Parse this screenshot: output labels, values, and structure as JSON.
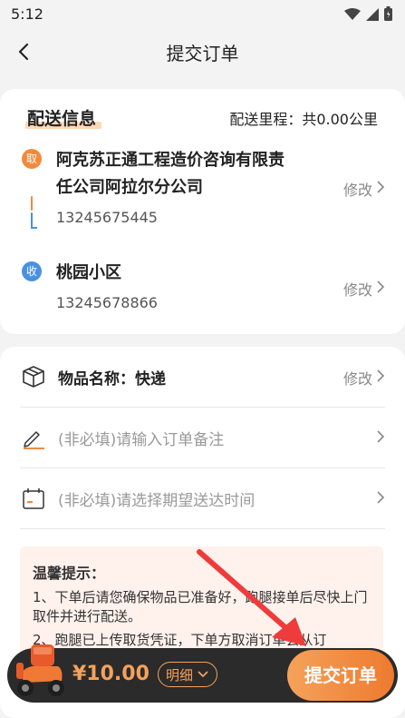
{
  "status": {
    "time": "5:12"
  },
  "nav": {
    "title": "提交订单"
  },
  "delivery": {
    "section_title": "配送信息",
    "distance": "配送里程：共0.00公里",
    "pickup": {
      "badge": "取",
      "name_line1": "阿克苏正通工程造价咨询有限责",
      "name_line2": "任公司阿拉尔分公司",
      "phone": "13245675445",
      "edit_label": "修改"
    },
    "receive": {
      "badge": "收",
      "name": "桃园小区",
      "phone": "13245678866",
      "edit_label": "修改"
    }
  },
  "item": {
    "label": "物品名称：快递",
    "edit_label": "修改",
    "remark_placeholder": "(非必填)请输入订单备注",
    "time_placeholder": "(非必填)请选择期望送达时间"
  },
  "tips": {
    "title": "温馨提示：",
    "lines": [
      "1、下单后请您确保物品已准备好，跑腿接单后尽快上门取件并进行配送。",
      "2、跑腿已上传取货凭证，下单方取消订单会从订"
    ]
  },
  "bottom": {
    "price": "¥10.00",
    "detail_label": "明细",
    "submit_label": "提交订单"
  },
  "colors": {
    "accent": "#ee7a2f",
    "blue": "#4a90e2",
    "annotation_arrow": "#ee3b3b"
  }
}
